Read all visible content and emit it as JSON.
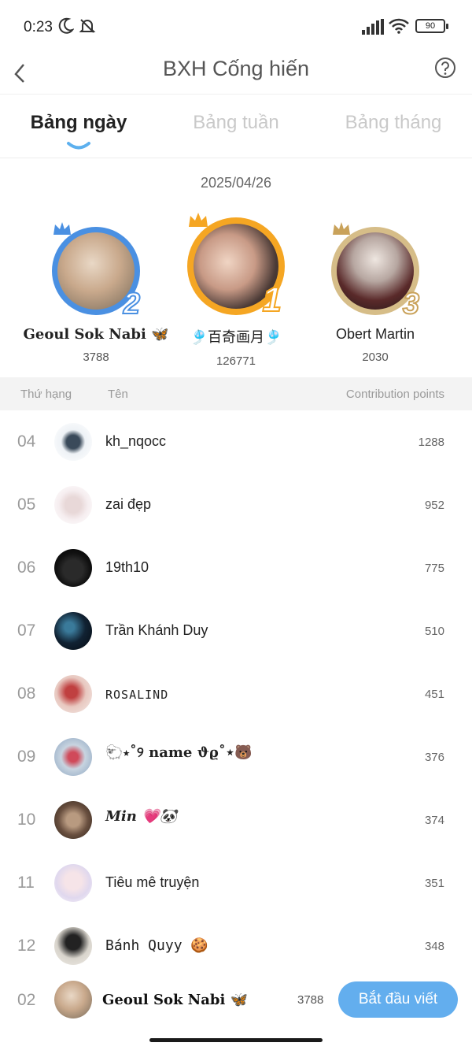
{
  "status": {
    "time": "0:23",
    "battery": "90"
  },
  "nav": {
    "title": "BXH Cống hiến",
    "back_icon": "chevron-left-icon",
    "help_icon": "question-circle-icon"
  },
  "tabs": [
    {
      "label": "Bảng ngày",
      "active": true
    },
    {
      "label": "Bảng tuần",
      "active": false
    },
    {
      "label": "Bảng tháng",
      "active": false
    }
  ],
  "date": "2025/04/26",
  "podium": {
    "first": {
      "rank": "1",
      "name": "🎐百奇画月🎐",
      "score": "126771"
    },
    "second": {
      "rank": "2",
      "name": "Geoul Sok Nabi 🦋",
      "score": "3788"
    },
    "third": {
      "rank": "3",
      "name": "Obert Martin",
      "score": "2030"
    }
  },
  "columns": {
    "rank": "Thứ hạng",
    "name": "Tên",
    "points": "Contribution points"
  },
  "rows": [
    {
      "rank": "04",
      "name": "kh_nqocc",
      "points": "1288"
    },
    {
      "rank": "05",
      "name": "zai đẹp",
      "points": "952"
    },
    {
      "rank": "06",
      "name": "19th10",
      "points": "775"
    },
    {
      "rank": "07",
      "name": "Trần Khánh Duy",
      "points": "510"
    },
    {
      "rank": "08",
      "name": "ROSALIND",
      "points": "451"
    },
    {
      "rank": "09",
      "name": "🐑⋆˚୨ name ϑϱ˚⋆🐻",
      "points": "376"
    },
    {
      "rank": "10",
      "name": "Min 💗🐼",
      "points": "374"
    },
    {
      "rank": "11",
      "name": "Tiêu mê truyện",
      "points": "351"
    },
    {
      "rank": "12",
      "name": "Bánh Quyy 🍪",
      "points": "348"
    }
  ],
  "me": {
    "rank": "02",
    "name": "Geoul Sok Nabi 🦋",
    "points": "3788",
    "cta": "Bắt đầu viết"
  },
  "colors": {
    "accent": "#63aeee",
    "gold": "#f5a623",
    "silver": "#4a90e2",
    "bronze": "#c9a25a"
  }
}
